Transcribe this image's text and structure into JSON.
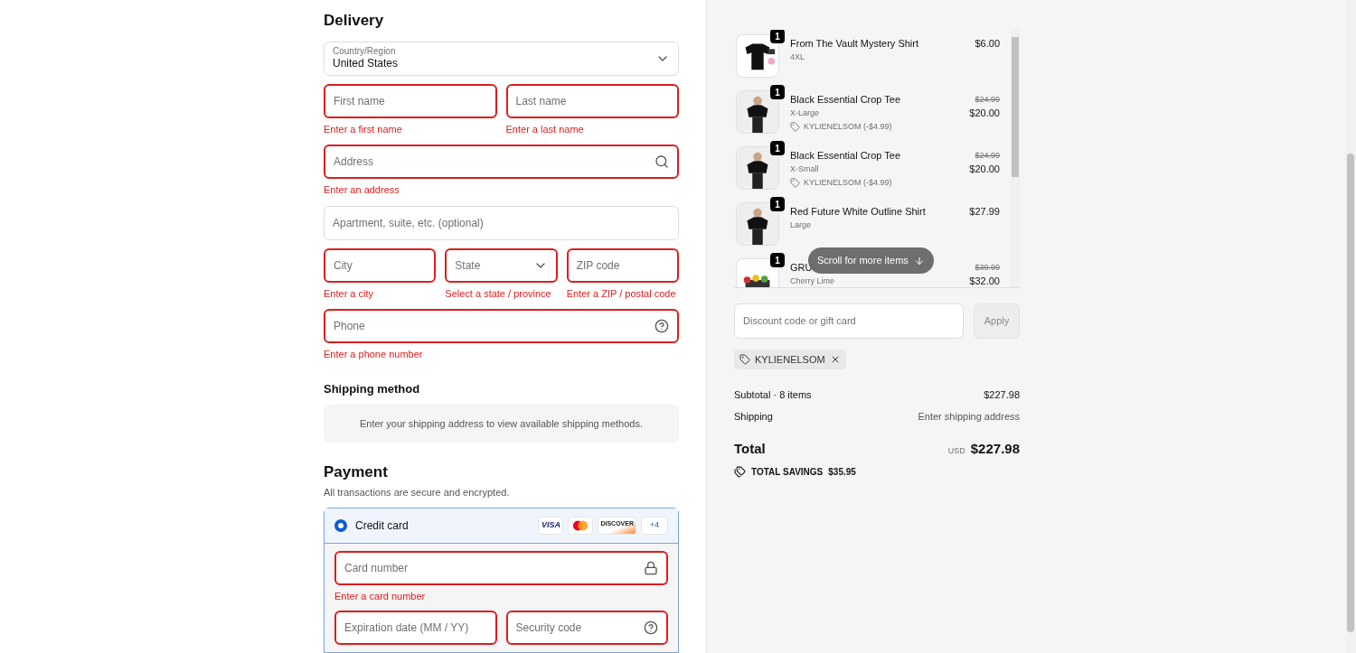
{
  "delivery": {
    "title": "Delivery",
    "country": {
      "label": "Country/Region",
      "value": "United States"
    },
    "rows": [
      [
        {
          "kind": "text",
          "placeholder": "First name",
          "invalid": true,
          "error": "Enter a first name"
        },
        {
          "kind": "text",
          "placeholder": "Last name",
          "invalid": true,
          "error": "Enter a last name"
        }
      ],
      [
        {
          "kind": "address",
          "placeholder": "Address",
          "invalid": true,
          "error": "Enter an address"
        }
      ],
      [
        {
          "kind": "text",
          "placeholder": "Apartment, suite, etc. (optional)",
          "invalid": false
        }
      ],
      [
        {
          "kind": "text",
          "placeholder": "City",
          "invalid": true,
          "error": "Enter a city"
        },
        {
          "kind": "select",
          "placeholder": "State",
          "invalid": true,
          "error": "Select a state / province"
        },
        {
          "kind": "text",
          "placeholder": "ZIP code",
          "invalid": true,
          "error": "Enter a ZIP / postal code"
        }
      ],
      [
        {
          "kind": "phone",
          "placeholder": "Phone",
          "invalid": true,
          "error": "Enter a phone number"
        }
      ]
    ]
  },
  "shipping_method": {
    "title": "Shipping method",
    "notice": "Enter your shipping address to view available shipping methods."
  },
  "payment": {
    "title": "Payment",
    "subtitle": "All transactions are secure and encrypted.",
    "method": {
      "label": "Credit card",
      "selected": true,
      "brands": [
        {
          "kind": "visa",
          "label": "VISA"
        },
        {
          "kind": "mastercard"
        },
        {
          "kind": "discover",
          "label": "DISCOVER"
        }
      ],
      "more": "+4"
    },
    "card_number": {
      "kind": "card_number",
      "placeholder": "Card number",
      "invalid": true,
      "error": "Enter a card number"
    },
    "row": [
      {
        "kind": "text",
        "placeholder": "Expiration date (MM / YY)",
        "invalid": true
      },
      {
        "kind": "security_code",
        "placeholder": "Security code",
        "invalid": true
      }
    ]
  },
  "cart": {
    "items": [
      {
        "name": "From The Vault Mystery Shirt",
        "variant": "4XL",
        "quantity": "1",
        "price": "$6.00"
      },
      {
        "name": "Black Essential Crop Tee",
        "variant": "X-Large",
        "quantity": "1",
        "original_price": "$24.99",
        "price": "$20.00",
        "discount": "KYLIENELSOM (-$4.99)"
      },
      {
        "name": "Black Essential Crop Tee",
        "variant": "X-Small",
        "quantity": "1",
        "original_price": "$24.99",
        "price": "$20.00",
        "discount": "KYLIENELSOM (-$4.99)"
      },
      {
        "name": "Red Future White Outline Shirt",
        "variant": "Large",
        "quantity": "1",
        "price": "$27.99"
      },
      {
        "name": "GRU",
        "variant": "Cherry Lime",
        "quantity": "1",
        "original_price": "$39.99",
        "price": "$32.00"
      }
    ],
    "scroll_hint": "Scroll for more items",
    "discount_placeholder": "Discount code or gift card",
    "apply": "Apply",
    "applied_code": "KYLIENELSOM",
    "subtotal_label": "Subtotal · 8 items",
    "subtotal": "$227.98",
    "shipping_label": "Shipping",
    "shipping": "Enter shipping address",
    "total_label": "Total",
    "currency": "USD",
    "total": "$227.98",
    "savings_label": "TOTAL SAVINGS",
    "savings": "$35.95"
  }
}
